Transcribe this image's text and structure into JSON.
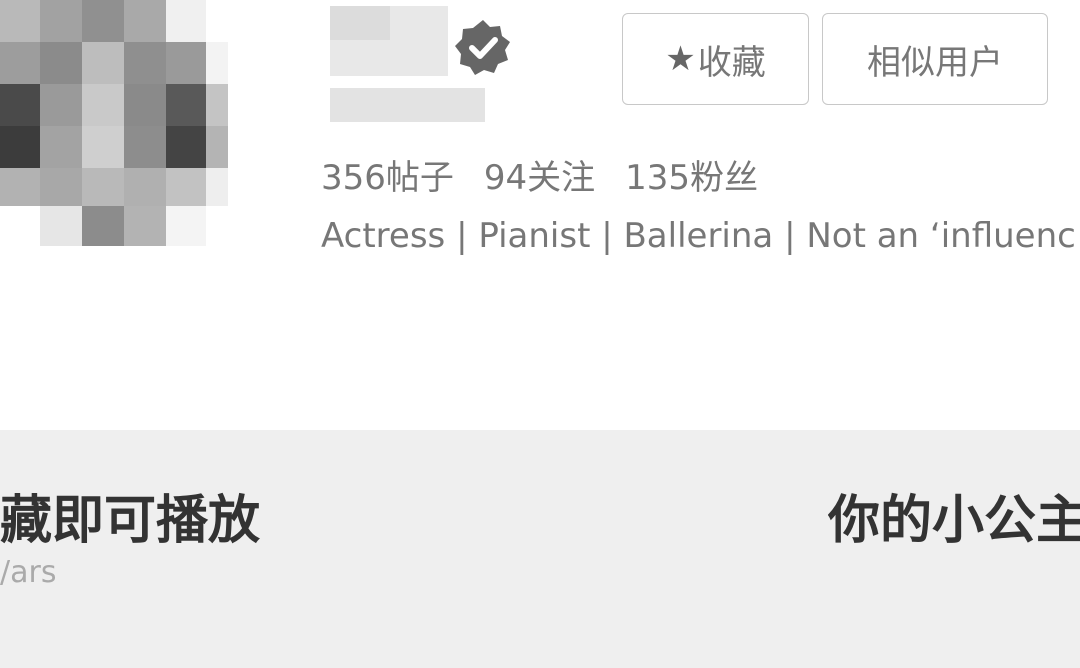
{
  "profile": {
    "buttons": {
      "favorite_star": "★",
      "favorite": "收藏",
      "similar_users": "相似用户"
    },
    "stats": [
      {
        "count": "356",
        "label": "帖子"
      },
      {
        "count": "94",
        "label": "关注"
      },
      {
        "count": "135",
        "label": "粉丝"
      }
    ],
    "bio": "Actress | Pianist | Ballerina | Not an ‘influenc"
  },
  "cards": [
    {
      "title": "藏即可播放",
      "subtitle": "/ars"
    },
    {
      "title": "你的小公主"
    }
  ],
  "colors": {
    "background": "#ffffff",
    "section_bg": "#efefef",
    "text_gray": "#777777",
    "verified_badge": "#666666"
  }
}
